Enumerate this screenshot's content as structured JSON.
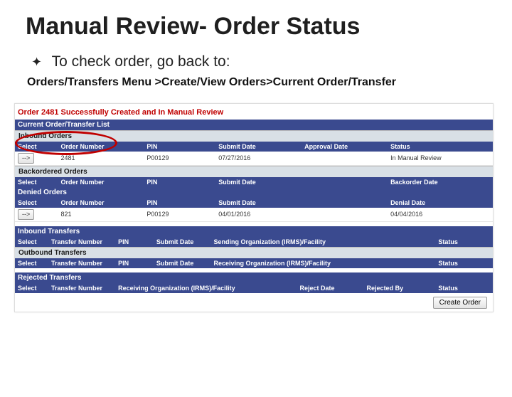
{
  "title": "Manual Review- Order Status",
  "bullet": "To check order, go back to:",
  "breadcrumb": "Orders/Transfers Menu >Create/View Orders>Current Order/Transfer",
  "success_msg": "Order 2481 Successfully Created and In Manual Review",
  "sections": {
    "current_list_title": "Current Order/Transfer List",
    "inbound_orders": {
      "label": "Inbound Orders",
      "headers": [
        "Select",
        "Order Number",
        "PIN",
        "Submit Date",
        "Approval Date",
        "Status"
      ],
      "rows": [
        {
          "select": "-->",
          "order_number": "2481",
          "pin": "P00129",
          "submit_date": "07/27/2016",
          "approval_date": "",
          "status": "In Manual Review"
        }
      ]
    },
    "backordered": {
      "label": "Backordered Orders",
      "headers": [
        "Select",
        "Order Number",
        "PIN",
        "Submit Date",
        "",
        "Backorder Date"
      ]
    },
    "denied": {
      "label": "Denied Orders",
      "headers": [
        "Select",
        "Order Number",
        "PIN",
        "Submit Date",
        "",
        "Denial Date"
      ],
      "rows": [
        {
          "select": "-->",
          "order_number": "821",
          "pin": "P00129",
          "submit_date": "04/01/2016",
          "c5": "",
          "denial_date": "04/04/2016"
        }
      ]
    },
    "inbound_transfers": {
      "label": "Inbound Transfers",
      "headers": [
        "Select",
        "Transfer Number",
        "PIN",
        "Submit Date",
        "Sending Organization (IRMS)/Facility",
        "Status"
      ]
    },
    "outbound_transfers": {
      "label": "Outbound Transfers",
      "headers": [
        "Select",
        "Transfer Number",
        "PIN",
        "Submit Date",
        "Receiving Organization (IRMS)/Facility",
        "Status"
      ]
    },
    "rejected_transfers": {
      "label": "Rejected Transfers",
      "headers": [
        "Select",
        "Transfer Number",
        "Receiving Organization (IRMS)/Facility",
        "Reject Date",
        "Rejected By",
        "Status"
      ]
    }
  },
  "buttons": {
    "arrow": "-->",
    "create_order": "Create Order"
  }
}
